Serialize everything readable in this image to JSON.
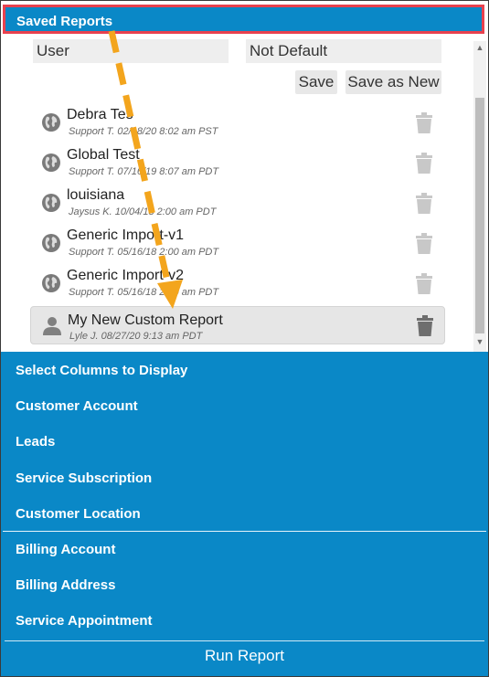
{
  "header": {
    "title": "Saved Reports"
  },
  "filters": {
    "owner_value": "User",
    "default_value": "Not Default"
  },
  "buttons": {
    "save_label": "Save",
    "save_as_new_label": "Save as New"
  },
  "reports": [
    {
      "name": "Debra Tes",
      "meta": "Support T.   02/18/20 8:02 am PST",
      "icon": "globe-icon"
    },
    {
      "name": "Global Test",
      "meta": "Support T.   07/16/19 8:07 am PDT",
      "icon": "globe-icon"
    },
    {
      "name": "louisiana",
      "meta": "Jaysus K.   10/04/18 2:00 am PDT",
      "icon": "globe-icon"
    },
    {
      "name": "Generic Import-v1",
      "meta": "Support T.   05/16/18 2:00 am PDT",
      "icon": "globe-icon"
    },
    {
      "name": "Generic Import-v2",
      "meta": "Support T.   05/16/18 2:00 am PDT",
      "icon": "globe-icon"
    },
    {
      "name": "My New Custom Report",
      "meta": "Lyle J.   08/27/20 9:13 am PDT",
      "icon": "person-icon",
      "selected": true
    }
  ],
  "menu": {
    "items": [
      "Select Columns to Display",
      "Customer Account",
      "Leads",
      "Service Subscription",
      "Customer Location",
      "Billing Account",
      "Billing Address",
      "Service Appointment"
    ]
  },
  "run_label": "Run Report",
  "colors": {
    "brand_blue": "#0a88c7",
    "highlight_red": "#e8414e",
    "arrow_orange": "#f3a51d"
  }
}
